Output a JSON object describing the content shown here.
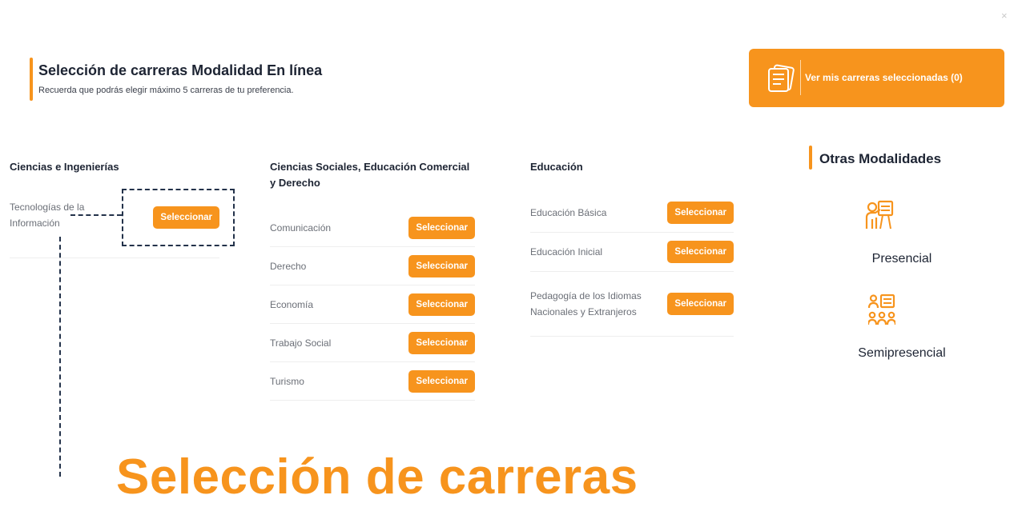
{
  "window": {
    "close_glyph": "×"
  },
  "header": {
    "title": "Selección de carreras Modalidad En línea",
    "subtitle": "Recuerda que podrás elegir máximo 5 carreras de tu preferencia."
  },
  "cta": {
    "label": "Ver mis carreras seleccionadas (0)",
    "icon": "documents-icon"
  },
  "select_label": "Seleccionar",
  "columns": [
    {
      "title": "Ciencias e Ingenierías",
      "careers": [
        "Tecnologías de la Información"
      ]
    },
    {
      "title": "Ciencias Sociales, Educación Comercial y Derecho",
      "careers": [
        "Comunicación",
        "Derecho",
        "Economía",
        "Trabajo Social",
        "Turismo"
      ]
    },
    {
      "title": "Educación",
      "careers": [
        "Educación Básica",
        "Educación Inicial",
        "Pedagogía de los Idiomas Nacionales y Extranjeros"
      ]
    }
  ],
  "sidebar": {
    "title": "Otras Modalidades",
    "modalities": [
      {
        "label": "Presencial",
        "icon": "teacher-board-icon"
      },
      {
        "label": "Semipresencial",
        "icon": "group-board-icon"
      }
    ]
  },
  "overlay": {
    "heading": "Selección de carreras"
  },
  "colors": {
    "accent": "#f7941d",
    "text": "#1d2433",
    "muted": "#6b6f77",
    "annotation": "#23324a"
  }
}
